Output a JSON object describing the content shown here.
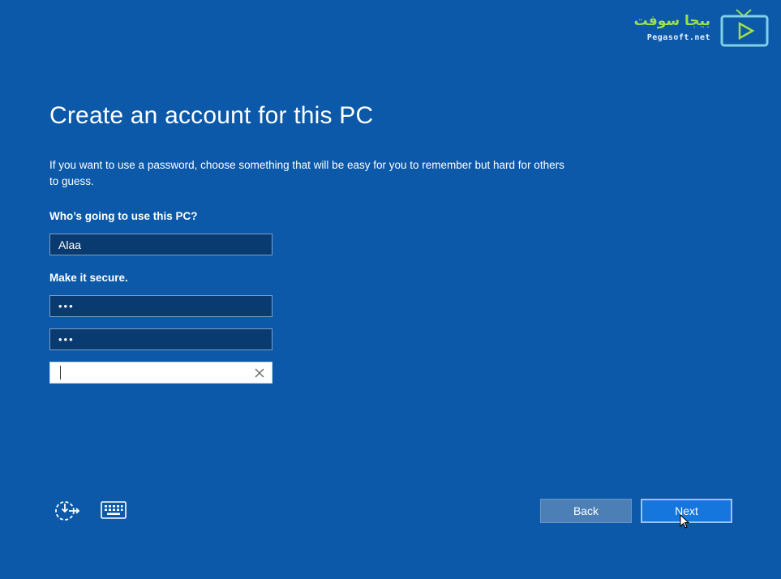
{
  "setup": {
    "title": "Create an account for this PC",
    "description": "If you want to use a password, choose something that will be easy for you to remember but hard for others to guess.",
    "user_label": "Who’s going to use this PC?",
    "username_value": "Alaa",
    "secure_label": "Make it secure.",
    "password_masked": "•••",
    "reenter_masked": "•••",
    "hint_value": ""
  },
  "buttons": {
    "back_label": "Back",
    "next_label": "Next"
  },
  "icons": {
    "accessibility": "ease-of-access-icon",
    "keyboard": "keyboard-icon",
    "clear": "close-icon"
  },
  "watermark": {
    "brand_arabic": "بيجا سوفت",
    "brand_url": "Pegasoft.net"
  },
  "colors": {
    "background": "#0b59a8",
    "field_dark": "#0a3b70",
    "next_button": "#1576dd",
    "back_button": "#4c7fb6",
    "brand_green": "#9ee04a"
  }
}
